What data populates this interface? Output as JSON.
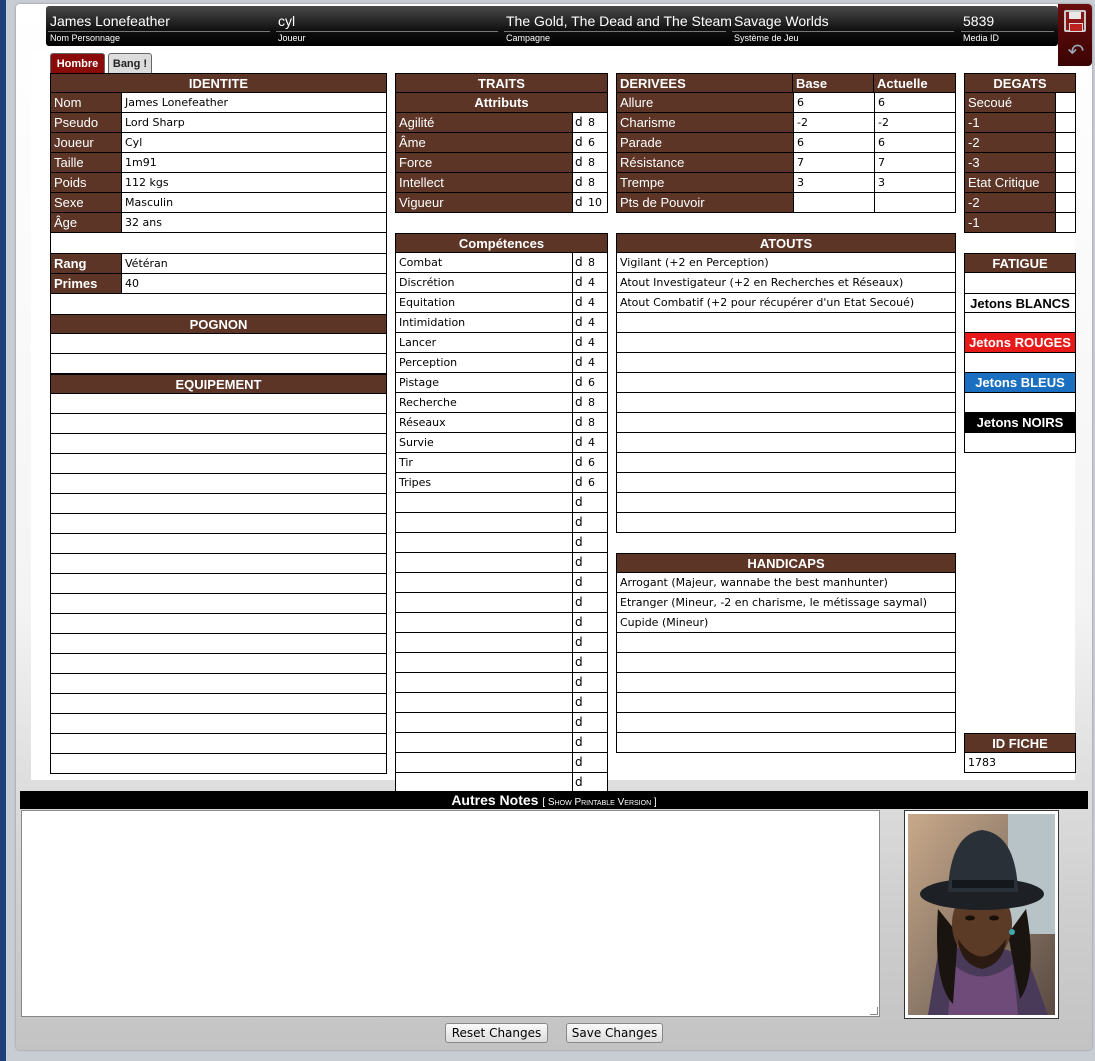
{
  "header": {
    "fields": [
      {
        "value": "James Lonefeather",
        "label": "Nom Personnage"
      },
      {
        "value": "cyl",
        "label": "Joueur"
      },
      {
        "value": "The Gold, The Dead and The Steam",
        "label": "Campagne"
      },
      {
        "value": "Savage Worlds",
        "label": "Système de Jeu"
      },
      {
        "value": "5839",
        "label": "Media ID"
      }
    ]
  },
  "tabs": [
    {
      "label": "Hombre",
      "active": true
    },
    {
      "label": "Bang !",
      "active": false
    }
  ],
  "identite": {
    "title": "IDENTITE",
    "rows": [
      {
        "label": "Nom",
        "value": "James Lonefeather"
      },
      {
        "label": "Pseudo",
        "value": "Lord Sharp"
      },
      {
        "label": "Joueur",
        "value": "Cyl"
      },
      {
        "label": "Taille",
        "value": "1m91"
      },
      {
        "label": "Poids",
        "value": "112 kgs"
      },
      {
        "label": "Sexe",
        "value": "Masculin"
      },
      {
        "label": "Âge",
        "value": "32 ans"
      }
    ],
    "rows2": [
      {
        "label": "Rang",
        "value": "Vétéran"
      },
      {
        "label": "Primes",
        "value": "40"
      }
    ]
  },
  "pognon": {
    "title": "POGNON"
  },
  "equipement": {
    "title": "EQUIPEMENT"
  },
  "traits": {
    "title": "TRAITS",
    "subtitle": "Attributs",
    "rows": [
      {
        "label": "Agilité",
        "d": "d",
        "die": "8"
      },
      {
        "label": "Âme",
        "d": "d",
        "die": "6"
      },
      {
        "label": "Force",
        "d": "d",
        "die": "8"
      },
      {
        "label": "Intellect",
        "d": "d",
        "die": "8"
      },
      {
        "label": "Vigueur",
        "d": "d",
        "die": "10"
      }
    ]
  },
  "competences": {
    "title": "Compétences",
    "rows": [
      {
        "label": "Combat",
        "d": "d",
        "die": "8"
      },
      {
        "label": "Discrétion",
        "d": "d",
        "die": "4"
      },
      {
        "label": "Equitation",
        "d": "d",
        "die": "4"
      },
      {
        "label": "Intimidation",
        "d": "d",
        "die": "4"
      },
      {
        "label": "Lancer",
        "d": "d",
        "die": "4"
      },
      {
        "label": "Perception",
        "d": "d",
        "die": "4"
      },
      {
        "label": "Pistage",
        "d": "d",
        "die": "6"
      },
      {
        "label": "Recherche",
        "d": "d",
        "die": "8"
      },
      {
        "label": "Réseaux",
        "d": "d",
        "die": "8"
      },
      {
        "label": "Survie",
        "d": "d",
        "die": "4"
      },
      {
        "label": "Tir",
        "d": "d",
        "die": "6"
      },
      {
        "label": "Tripes",
        "d": "d",
        "die": "6"
      },
      {
        "label": "",
        "d": "d",
        "die": ""
      },
      {
        "label": "",
        "d": "d",
        "die": ""
      },
      {
        "label": "",
        "d": "d",
        "die": ""
      },
      {
        "label": "",
        "d": "d",
        "die": ""
      },
      {
        "label": "",
        "d": "d",
        "die": ""
      },
      {
        "label": "",
        "d": "d",
        "die": ""
      },
      {
        "label": "",
        "d": "d",
        "die": ""
      },
      {
        "label": "",
        "d": "d",
        "die": ""
      },
      {
        "label": "",
        "d": "d",
        "die": ""
      },
      {
        "label": "",
        "d": "d",
        "die": ""
      },
      {
        "label": "",
        "d": "d",
        "die": ""
      },
      {
        "label": "",
        "d": "d",
        "die": ""
      },
      {
        "label": "",
        "d": "d",
        "die": ""
      },
      {
        "label": "",
        "d": "d",
        "die": ""
      },
      {
        "label": "",
        "d": "d",
        "die": ""
      }
    ]
  },
  "derivees": {
    "title": "DERIVEES",
    "col_base": "Base",
    "col_actuelle": "Actuelle",
    "rows": [
      {
        "label": "Allure",
        "base": "6",
        "actuelle": "6"
      },
      {
        "label": "Charisme",
        "base": "-2",
        "actuelle": "-2"
      },
      {
        "label": "Parade",
        "base": "6",
        "actuelle": "6"
      },
      {
        "label": "Résistance",
        "base": "7",
        "actuelle": "7"
      },
      {
        "label": "Trempe",
        "base": "3",
        "actuelle": "3"
      },
      {
        "label": "Pts de Pouvoir",
        "base": "",
        "actuelle": ""
      }
    ]
  },
  "atouts": {
    "title": "ATOUTS",
    "rows": [
      "Vigilant (+2 en Perception)",
      "Atout Investigateur (+2 en Recherches et Réseaux)",
      "Atout Combatif (+2 pour récupérer d'un Etat Secoué)",
      "",
      "",
      "",
      "",
      "",
      "",
      "",
      "",
      "",
      "",
      ""
    ]
  },
  "handicaps": {
    "title": "HANDICAPS",
    "rows": [
      "Arrogant (Majeur, wannabe the best manhunter)",
      "Etranger (Mineur, -2 en charisme, le métissage saymal)",
      "Cupide (Mineur)",
      "",
      "",
      "",
      "",
      "",
      ""
    ]
  },
  "degats": {
    "title": "DEGATS",
    "rows": [
      "Secoué",
      "-1",
      "-2",
      "-3",
      "Etat Critique",
      "-2",
      "-1"
    ]
  },
  "fatigue": {
    "title": "FATIGUE"
  },
  "jetons": [
    {
      "label": "Jetons BLANCS",
      "bg": "#ffffff",
      "fg": "#000000"
    },
    {
      "label": "Jetons ROUGES",
      "bg": "#e81919",
      "fg": "#ffffff"
    },
    {
      "label": "Jetons BLEUS",
      "bg": "#1a6fc0",
      "fg": "#ffffff"
    },
    {
      "label": "Jetons NOIRS",
      "bg": "#000000",
      "fg": "#ffffff"
    }
  ],
  "id_fiche": {
    "title": "ID FICHE",
    "value": "1783"
  },
  "notes": {
    "title": "Autres Notes",
    "link": "[ Show Printable Version ]",
    "value": ""
  },
  "buttons": {
    "reset": "Reset Changes",
    "save": "Save Changes"
  },
  "colors": {
    "section_header": "#5c3526",
    "active_tab": "#8b0b0b"
  }
}
